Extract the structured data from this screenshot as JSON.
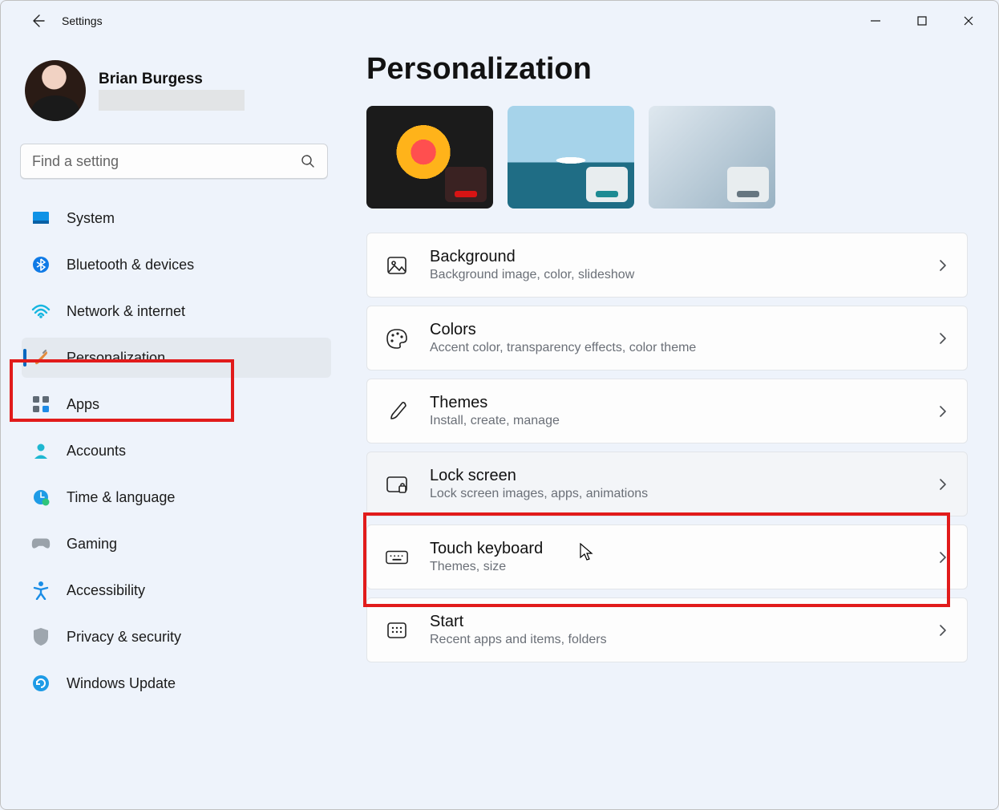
{
  "window": {
    "title": "Settings"
  },
  "user": {
    "name": "Brian Burgess"
  },
  "search": {
    "placeholder": "Find a setting"
  },
  "nav": [
    {
      "label": "System"
    },
    {
      "label": "Bluetooth & devices"
    },
    {
      "label": "Network & internet"
    },
    {
      "label": "Personalization"
    },
    {
      "label": "Apps"
    },
    {
      "label": "Accounts"
    },
    {
      "label": "Time & language"
    },
    {
      "label": "Gaming"
    },
    {
      "label": "Accessibility"
    },
    {
      "label": "Privacy & security"
    },
    {
      "label": "Windows Update"
    }
  ],
  "page": {
    "title": "Personalization"
  },
  "cards": [
    {
      "title": "Background",
      "subtitle": "Background image, color, slideshow"
    },
    {
      "title": "Colors",
      "subtitle": "Accent color, transparency effects, color theme"
    },
    {
      "title": "Themes",
      "subtitle": "Install, create, manage"
    },
    {
      "title": "Lock screen",
      "subtitle": "Lock screen images, apps, animations"
    },
    {
      "title": "Touch keyboard",
      "subtitle": "Themes, size"
    },
    {
      "title": "Start",
      "subtitle": "Recent apps and items, folders"
    }
  ]
}
